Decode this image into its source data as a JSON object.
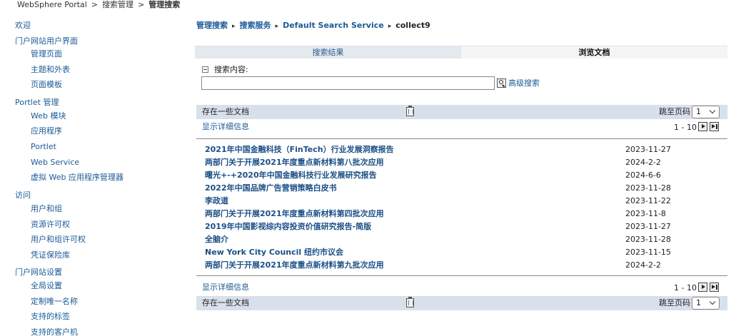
{
  "breadcrumb_top": {
    "items": [
      "WebSphere Portal",
      "搜索管理",
      "管理搜索"
    ],
    "separator": ">"
  },
  "sidebar": {
    "sections": [
      {
        "label": "欢迎",
        "children": []
      },
      {
        "label": "门户网站用户界面",
        "children": [
          "管理页面",
          "主题和外表",
          "页面模板"
        ]
      },
      {
        "label": "Portlet 管理",
        "children": [
          "Web 模块",
          "应用程序",
          "Portlet",
          "Web Service",
          "虚拟 Web 应用程序管理器"
        ]
      },
      {
        "label": "访问",
        "children": [
          "用户和组",
          "资源许可权",
          "用户和组许可权",
          "凭证保险库"
        ]
      },
      {
        "label": "门户网站设置",
        "children": [
          "全局设置",
          "定制唯一名称",
          "支持的标签",
          "支持的客户机"
        ]
      }
    ]
  },
  "main": {
    "breadcrumb": [
      "管理搜索",
      "搜索服务",
      "Default Search Service",
      "collect9"
    ],
    "tabs": [
      {
        "label": "搜索结果",
        "active": false
      },
      {
        "label": "浏览文档",
        "active": true
      }
    ],
    "search": {
      "heading": "搜索内容:",
      "value": "",
      "advanced_link": "高级搜索"
    },
    "toolbar": {
      "store_label": "存在一些文档",
      "jump_label": "跳至页码",
      "page_value": "1",
      "detail_label": "显示详细信息",
      "range_label": "1 - 10"
    },
    "results": [
      {
        "title": "2021年中国金融科技（FinTech）行业发展洞察报告",
        "date": "2023-11-27"
      },
      {
        "title": "两部门关于开展2021年度重点新材料第八批次应用",
        "date": "2024-2-2"
      },
      {
        "title": "曙光+-+2020年中国金融科技行业发展研究报告",
        "date": "2024-6-6"
      },
      {
        "title": "2022年中国品牌广告营销策略白皮书",
        "date": "2023-11-28"
      },
      {
        "title": "李政道",
        "date": "2023-11-22"
      },
      {
        "title": "两部门关于开展2021年度重点新材料第四批次应用",
        "date": "2023-11-8"
      },
      {
        "title": "2019年中国影视综内容投资价值研究报告-简版",
        "date": "2023-11-27"
      },
      {
        "title": "全脑介",
        "date": "2023-11-28"
      },
      {
        "title": "New York City Council 纽约市议会",
        "date": "2023-11-15"
      },
      {
        "title": "两部门关于开展2021年度重点新材料第九批次应用",
        "date": "2024-2-2"
      }
    ]
  },
  "colors": {
    "link": "#1b5a96",
    "result_link": "#1b4f86",
    "toolbar_bg": "#d8e0ec",
    "tab_inactive_bg": "#e4e9f0"
  }
}
